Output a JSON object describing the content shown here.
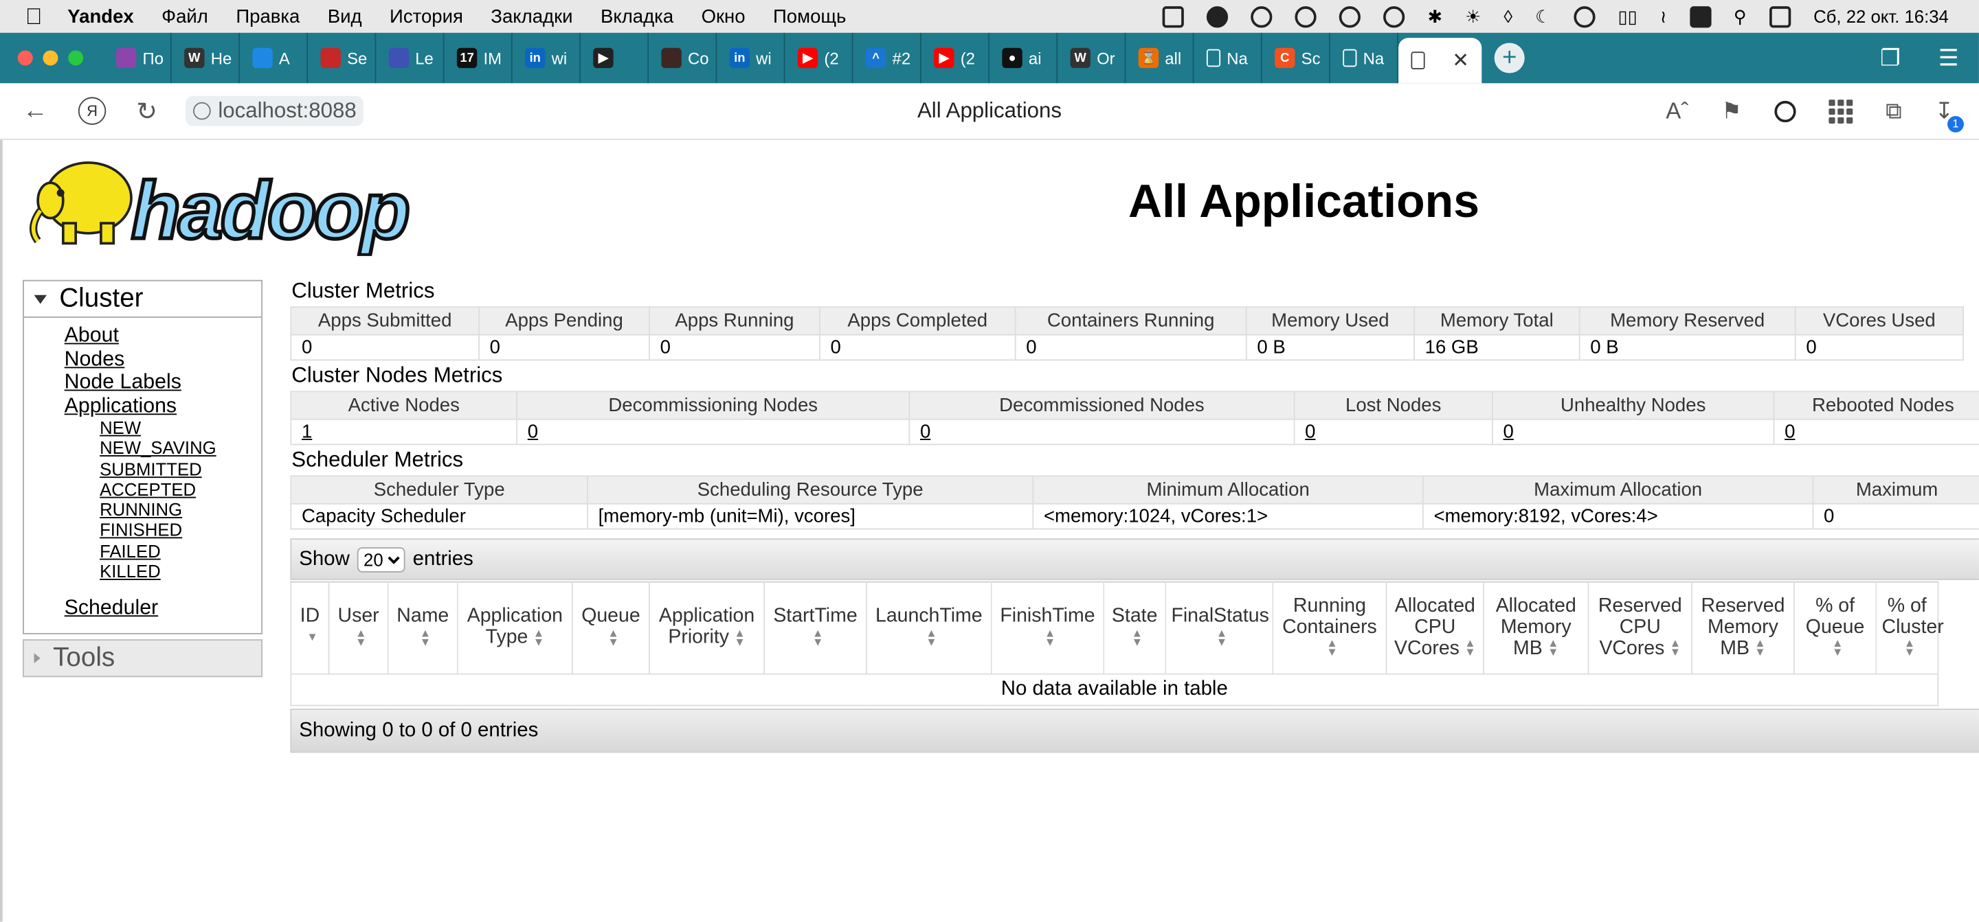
{
  "menubar": {
    "app": "Yandex",
    "items": [
      "Файл",
      "Правка",
      "Вид",
      "История",
      "Закладки",
      "Вкладка",
      "Окно",
      "Помощь"
    ],
    "datetime": "Сб, 22 окт.  16:34"
  },
  "tabs": [
    {
      "label": "По",
      "color": "#8e44ad",
      "icon": "site-favicon"
    },
    {
      "label": "He",
      "color": "#333333",
      "icon": "wikipedia-favicon",
      "glyph": "W"
    },
    {
      "label": "A",
      "color": "#1e88e5",
      "icon": "docker-favicon"
    },
    {
      "label": "Se",
      "color": "#c62828",
      "icon": "site-favicon"
    },
    {
      "label": "Le",
      "color": "#3f51b5",
      "icon": "site-favicon"
    },
    {
      "label": "IM",
      "color": "#111111",
      "icon": "tradingview-favicon",
      "glyph": "17"
    },
    {
      "label": "wi",
      "color": "#0a66c2",
      "icon": "linkedin-favicon",
      "glyph": "in"
    },
    {
      "label": "",
      "color": "#222222",
      "icon": "video-favicon",
      "glyph": "▶"
    },
    {
      "label": "Co",
      "color": "#3e2723",
      "icon": "site-favicon"
    },
    {
      "label": "wi",
      "color": "#0a66c2",
      "icon": "linkedin-favicon",
      "glyph": "in"
    },
    {
      "label": "(2",
      "color": "#ff0000",
      "icon": "youtube-favicon",
      "glyph": "▶"
    },
    {
      "label": "#2",
      "color": "#1976d2",
      "icon": "site-favicon",
      "glyph": "^"
    },
    {
      "label": "(2",
      "color": "#ff0000",
      "icon": "youtube-favicon",
      "glyph": "▶"
    },
    {
      "label": "ai",
      "color": "#111111",
      "icon": "github-favicon",
      "glyph": "●"
    },
    {
      "label": "Or",
      "color": "#333333",
      "icon": "wikipedia-favicon",
      "glyph": "W"
    },
    {
      "label": "all",
      "color": "#ef6c00",
      "icon": "hourglass-favicon",
      "glyph": "⌛"
    },
    {
      "label": "Na",
      "color": "transparent",
      "icon": "page-favicon"
    },
    {
      "label": "Sc",
      "color": "#f4511e",
      "icon": "site-favicon",
      "glyph": "C"
    },
    {
      "label": "Na",
      "color": "transparent",
      "icon": "page-favicon"
    }
  ],
  "address": {
    "url": "localhost:8088",
    "page_title": "All Applications"
  },
  "download_badge": "1",
  "page": {
    "title": "All Applications"
  },
  "sidebar": {
    "cluster_title": "Cluster",
    "links": [
      "About",
      "Nodes",
      "Node Labels",
      "Applications"
    ],
    "app_states": [
      "NEW",
      "NEW_SAVING",
      "SUBMITTED",
      "ACCEPTED",
      "RUNNING",
      "FINISHED",
      "FAILED",
      "KILLED"
    ],
    "scheduler": "Scheduler",
    "tools_title": "Tools"
  },
  "cluster_metrics": {
    "title": "Cluster Metrics",
    "headers": [
      "Apps Submitted",
      "Apps Pending",
      "Apps Running",
      "Apps Completed",
      "Containers Running",
      "Memory Used",
      "Memory Total",
      "Memory Reserved",
      "VCores Used"
    ],
    "values": [
      "0",
      "0",
      "0",
      "0",
      "0",
      "0 B",
      "16 GB",
      "0 B",
      "0"
    ]
  },
  "node_metrics": {
    "title": "Cluster Nodes Metrics",
    "headers": [
      "Active Nodes",
      "Decommissioning Nodes",
      "Decommissioned Nodes",
      "Lost Nodes",
      "Unhealthy Nodes",
      "Rebooted Nodes"
    ],
    "values": [
      "1",
      "0",
      "0",
      "0",
      "0",
      "0"
    ]
  },
  "scheduler_metrics": {
    "title": "Scheduler Metrics",
    "headers": [
      "Scheduler Type",
      "Scheduling Resource Type",
      "Minimum Allocation",
      "Maximum Allocation",
      "Maximum"
    ],
    "values": [
      "Capacity Scheduler",
      "[memory-mb (unit=Mi), vcores]",
      "<memory:1024, vCores:1>",
      "<memory:8192, vCores:4>",
      "0"
    ]
  },
  "apps_table": {
    "show_label": "Show",
    "entries_label": "entries",
    "page_size": "20",
    "columns": [
      "ID",
      "User",
      "Name",
      "Application Type",
      "Queue",
      "Application Priority",
      "StartTime",
      "LaunchTime",
      "FinishTime",
      "State",
      "FinalStatus",
      "Running Containers",
      "Allocated CPU VCores",
      "Allocated Memory MB",
      "Reserved CPU VCores",
      "Reserved Memory MB",
      "% of Queue",
      "% of Cluster"
    ],
    "empty_message": "No data available in table",
    "footer": "Showing 0 to 0 of 0 entries"
  }
}
